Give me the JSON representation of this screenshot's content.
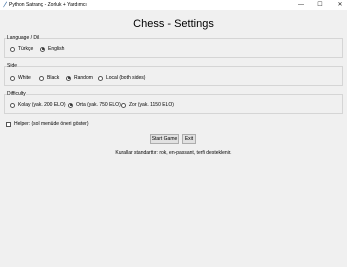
{
  "window": {
    "title": "Python Satranç - Zorluk + Yardımcı",
    "controls": {
      "minimize": "—",
      "maximize": "☐",
      "close": "✕"
    }
  },
  "page_title": "Chess - Settings",
  "language_group": {
    "caption": "Language / Dil",
    "options": [
      {
        "label": "Türkçe",
        "checked": false
      },
      {
        "label": "English",
        "checked": true
      }
    ]
  },
  "side_group": {
    "caption": "Side",
    "options": [
      {
        "label": "White",
        "checked": false
      },
      {
        "label": "Black",
        "checked": false
      },
      {
        "label": "Random",
        "checked": true
      },
      {
        "label": "Local (both sides)",
        "checked": false
      }
    ]
  },
  "difficulty_group": {
    "caption": "Difficulty",
    "options": [
      {
        "label": "Kolay (yak. 200 ELO)",
        "checked": false
      },
      {
        "label": "Orta (yak. 750 ELO)",
        "checked": true
      },
      {
        "label": "Zor (yak. 1150 ELO)",
        "checked": false
      }
    ]
  },
  "helper": {
    "label": "Helper: (sol menüde öneri göster)",
    "checked": false
  },
  "buttons": {
    "start": "Start Game",
    "exit": "Exit"
  },
  "rules_text": "Kurallar standarttır: rok, en-passant, terfi desteklenir."
}
